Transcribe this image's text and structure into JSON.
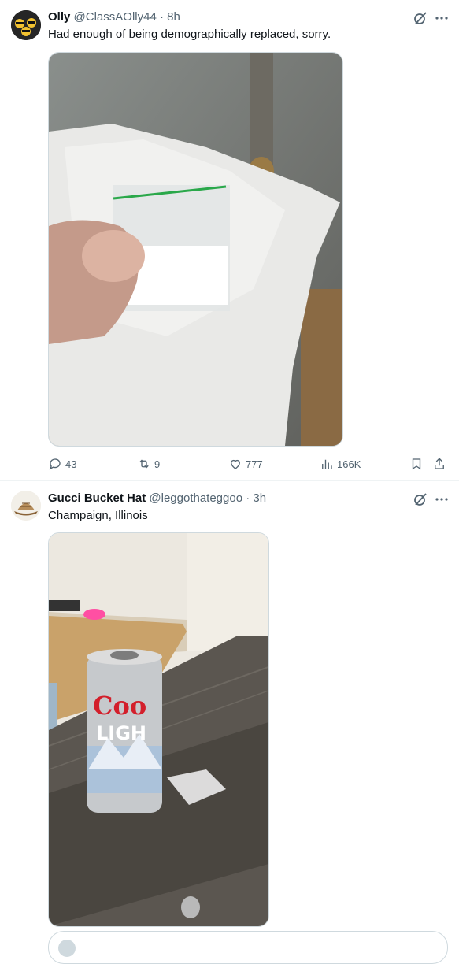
{
  "tweets": [
    {
      "name": "Olly",
      "handle": "@ClassAOlly44",
      "separator": "·",
      "time": "8h",
      "text": "Had enough of being demographically replaced, sorry.",
      "stats": {
        "replies": "43",
        "reposts": "9",
        "likes": "777",
        "views": "166K"
      },
      "avatar_icon": "emoji-group-avatar",
      "media_description_icon": "photo"
    },
    {
      "name": "Gucci Bucket Hat",
      "handle": "@leggothateggoo",
      "separator": "·",
      "time": "3h",
      "text": "Champaign, Illinois",
      "avatar_icon": "bucket-hat-avatar",
      "can_text": {
        "brand": "Coo",
        "sub": "LIGH"
      }
    }
  ],
  "colors": {
    "secondary": "#536471",
    "border": "#cfd9de",
    "divider": "#eff3f4"
  }
}
